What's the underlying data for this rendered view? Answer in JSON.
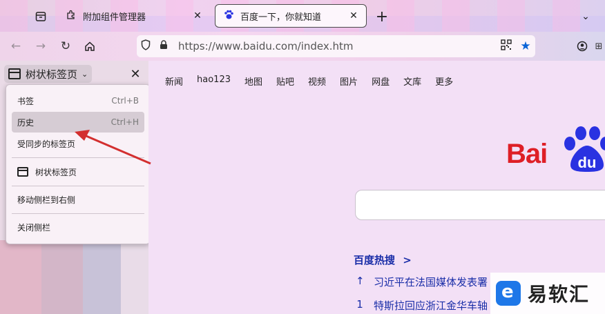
{
  "tabs": [
    {
      "label": "附加组件管理器",
      "icon": "puzzle-icon",
      "active": false
    },
    {
      "label": "百度一下，你就知道",
      "icon": "baidu-paw-icon",
      "active": true
    }
  ],
  "url": "https://www.baidu.com/index.htm",
  "sidebar": {
    "title": "树状标签页",
    "menu": [
      {
        "label": "书签",
        "shortcut": "Ctrl+B"
      },
      {
        "label": "历史",
        "shortcut": "Ctrl+H"
      },
      {
        "label": "受同步的标签页"
      },
      {
        "label": "树状标签页"
      },
      {
        "label": "移动侧栏到右侧"
      },
      {
        "label": "关闭侧栏"
      }
    ]
  },
  "page": {
    "nav": [
      "新闻",
      "hao123",
      "地图",
      "贴吧",
      "视频",
      "图片",
      "网盘",
      "文库",
      "更多"
    ],
    "logo": {
      "left": "Bai",
      "right": "du"
    },
    "hot": {
      "title": "百度热搜",
      "title_suffix": ">",
      "items": [
        {
          "rank": "↑",
          "text": "习近平在法国媒体发表署"
        },
        {
          "rank": "1",
          "text": "特斯拉回应浙江金华车轴"
        }
      ]
    }
  },
  "watermark": "易软汇",
  "colors": {
    "baidu_red": "#de1f26",
    "baidu_blue": "#2932e1",
    "link_blue": "#1a2ea8",
    "annotation_arrow": "#d32f2f"
  }
}
